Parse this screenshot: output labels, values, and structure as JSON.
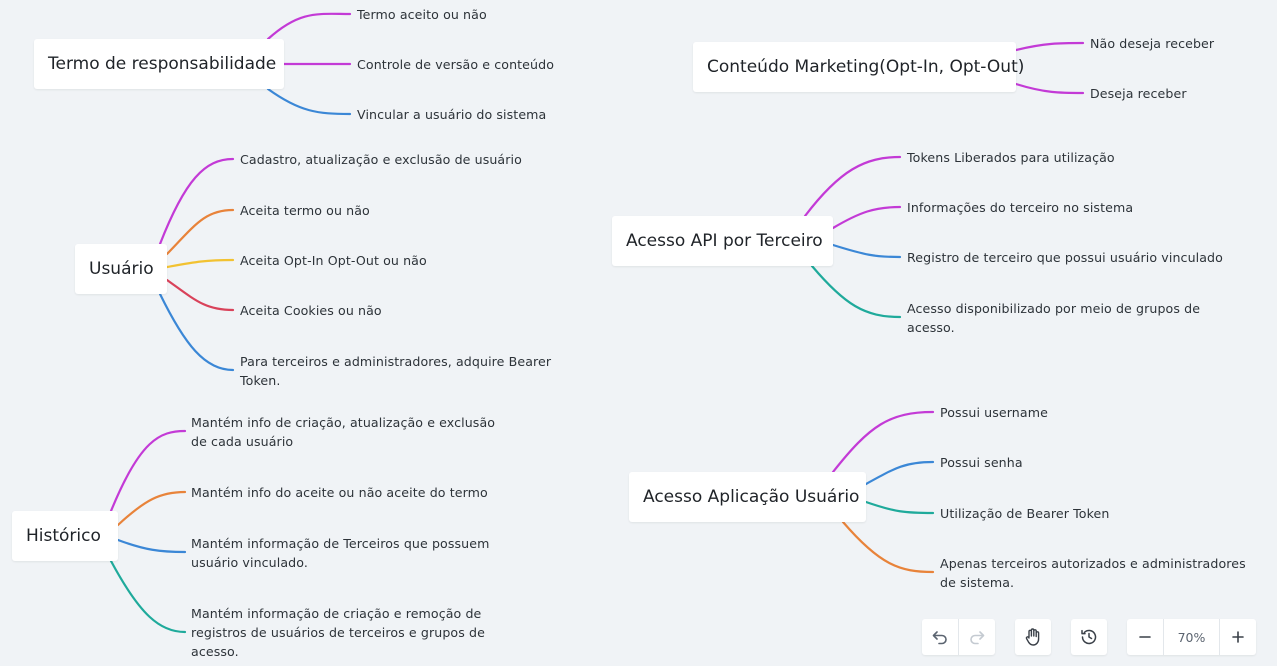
{
  "topics": {
    "termo": {
      "title": "Termo de responsabilidade",
      "children": [
        "Termo aceito ou não",
        "Controle de versão e conteúdo",
        "Vincular a usuário do sistema"
      ]
    },
    "usuario": {
      "title": "Usuário",
      "children": [
        "Cadastro, atualização e exclusão de usuário",
        "Aceita termo ou não",
        "Aceita Opt-In Opt-Out ou não",
        "Aceita Cookies ou não",
        "Para terceiros e administradores, adquire Bearer Token."
      ]
    },
    "historico": {
      "title": "Histórico",
      "children": [
        "Mantém info de criação, atualização e exclusão de cada usuário",
        "Mantém info do aceite ou não aceite do termo",
        "Mantém informação de Terceiros que possuem usuário vinculado.",
        "Mantém informação de criação e remoção de registros de usuários de terceiros e grupos de acesso."
      ]
    },
    "marketing": {
      "title": "Conteúdo Marketing(Opt-In, Opt-Out)",
      "children": [
        "Não deseja receber",
        "Deseja receber"
      ]
    },
    "api": {
      "title": "Acesso API por Terceiro",
      "children": [
        "Tokens Liberados para utilização",
        "Informações do terceiro no sistema",
        "Registro de terceiro que possui usuário vinculado",
        "Acesso disponibilizado por meio de grupos de acesso."
      ]
    },
    "aplicacao": {
      "title": "Acesso Aplicação Usuário",
      "children": [
        "Possui username",
        "Possui senha",
        "Utilização de Bearer Token",
        "Apenas terceiros autorizados e administradores de sistema."
      ]
    }
  },
  "colors": {
    "purple": "#c33ad6",
    "blue": "#3b87d6",
    "orange": "#e8833a",
    "yellow": "#f2c231",
    "red": "#d9425a",
    "teal": "#1faa9b"
  },
  "toolbar": {
    "undo_icon": "undo-icon",
    "redo_icon": "redo-icon",
    "hand_icon": "hand-icon",
    "history_icon": "history-icon",
    "zoom_out_icon": "minus-icon",
    "zoom_in_icon": "plus-icon",
    "zoom_level": "70%"
  }
}
